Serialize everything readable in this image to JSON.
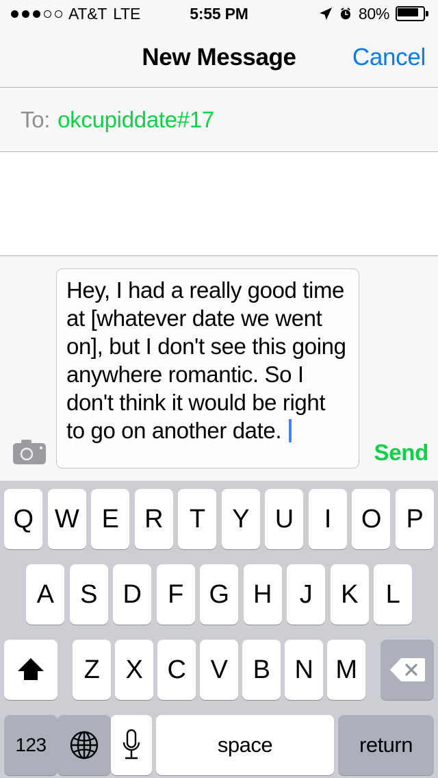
{
  "status_bar": {
    "signal_dots_filled": 3,
    "signal_dots_total": 5,
    "carrier": "AT&T",
    "network": "LTE",
    "time": "5:55 PM",
    "location_icon": "location-arrow-icon",
    "alarm_icon": "alarm-clock-icon",
    "battery_percent": "80%",
    "battery_level": 80
  },
  "nav_bar": {
    "title": "New Message",
    "cancel_label": "Cancel"
  },
  "recipient": {
    "label": "To:",
    "value": "okcupiddate#17",
    "value_color": "#0ed145"
  },
  "compose": {
    "camera_icon": "camera-icon",
    "message_text": "Hey, I had a really good time at [whatever date we went on], but I don't see this going anywhere romantic. So I don't think it would be right to go on another date. ",
    "send_label": "Send",
    "send_color": "#0ed145",
    "caret_color": "#4a7dff"
  },
  "keyboard": {
    "row1": [
      "Q",
      "W",
      "E",
      "R",
      "T",
      "Y",
      "U",
      "I",
      "O",
      "P"
    ],
    "row2": [
      "A",
      "S",
      "D",
      "F",
      "G",
      "H",
      "J",
      "K",
      "L"
    ],
    "row3_letters": [
      "Z",
      "X",
      "C",
      "V",
      "B",
      "N",
      "M"
    ],
    "shift_icon": "shift-arrow-icon",
    "backspace_icon": "backspace-delete-icon",
    "numeric_label": "123",
    "globe_icon": "globe-language-icon",
    "mic_icon": "microphone-icon",
    "space_label": "space",
    "return_label": "return"
  }
}
